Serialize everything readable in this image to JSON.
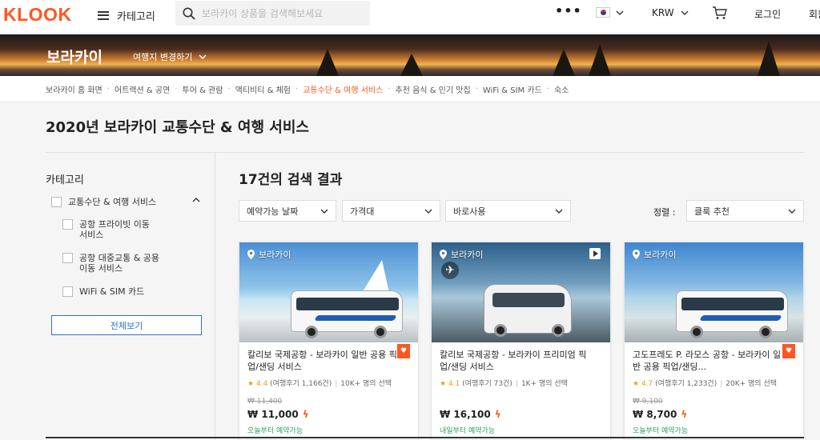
{
  "header": {
    "logo": "KLOOK",
    "category_label": "카테고리",
    "search_placeholder": "보라카이 상품을 검색해보세요",
    "more_label": "•••",
    "currency": "KRW",
    "login_label": "로그인",
    "signup_label": "회원가입",
    "flag": "korea-flag-icon"
  },
  "banner": {
    "title": "보라카이",
    "change_destination": "여행지 변경하기"
  },
  "breadcrumbs": [
    "보라카이 홈 화면",
    "어트랙션 & 공연",
    "투어 & 관람",
    "액티비티 & 체험",
    "교통수단 & 여행 서비스",
    "추천 음식 & 인기 맛집",
    "WiFi & SIM 카드",
    "숙소"
  ],
  "page_title": "2020년 보라카이 교통수단 & 여행 서비스",
  "sidebar": {
    "heading": "카테고리",
    "parent_category": "교통수단 & 여행 서비스",
    "sub_private": "공항 프라이빗 이동 서비스",
    "sub_private_line1": "공항 프라이빗 이동",
    "sub_private_line2": "서비스",
    "sub_public_line1": "공항 대중교통 & 공용",
    "sub_public_line2": "이동 서비스",
    "sub_wifi": "WiFi & SIM 카드",
    "view_all": "전체보기"
  },
  "results": {
    "heading": "17건의 검색 결과",
    "filters": {
      "date": "예약가능 날짜",
      "price": "가격대",
      "instant": "바로사용"
    },
    "sort_label": "정렬 :",
    "sort_value": "클룩 추천"
  },
  "cards": [
    {
      "location": "보라카이",
      "name": "칼리보 국제공항 - 보라카이 일반 공용 픽업/샌딩 서비스",
      "score": "4.4",
      "reviews": "(여행후기 1,166건)",
      "booked": "10K+ 명의 선택",
      "orig_price": "₩ 11,400",
      "price": "₩ 11,000",
      "availability": "오늘부터 예약가능"
    },
    {
      "location": "보라카이",
      "name": "칼리보 국제공항 - 보라카이 프리미엄 픽업/샌딩 서비스",
      "score": "4.1",
      "reviews": "(여행후기 73건)",
      "booked": "1K+ 명의 선택",
      "orig_price": "",
      "price": "₩ 16,100",
      "availability": "내일부터 예약가능"
    },
    {
      "location": "보라카이",
      "name": "고도프레도 P. 라모스 공항 - 보라카이 일반 공용 픽업/샌딩...",
      "score": "4.7",
      "reviews": "(여행후기 1,233건)",
      "booked": "20K+ 명의 선택",
      "orig_price": "₩ 9,100",
      "price": "₩ 8,700",
      "availability": "오늘부터 예약가능"
    }
  ],
  "colors": {
    "brand": "#ff5722",
    "link_blue": "#2f6fd6",
    "star": "#f09b1a",
    "available_green": "#26a65b"
  }
}
